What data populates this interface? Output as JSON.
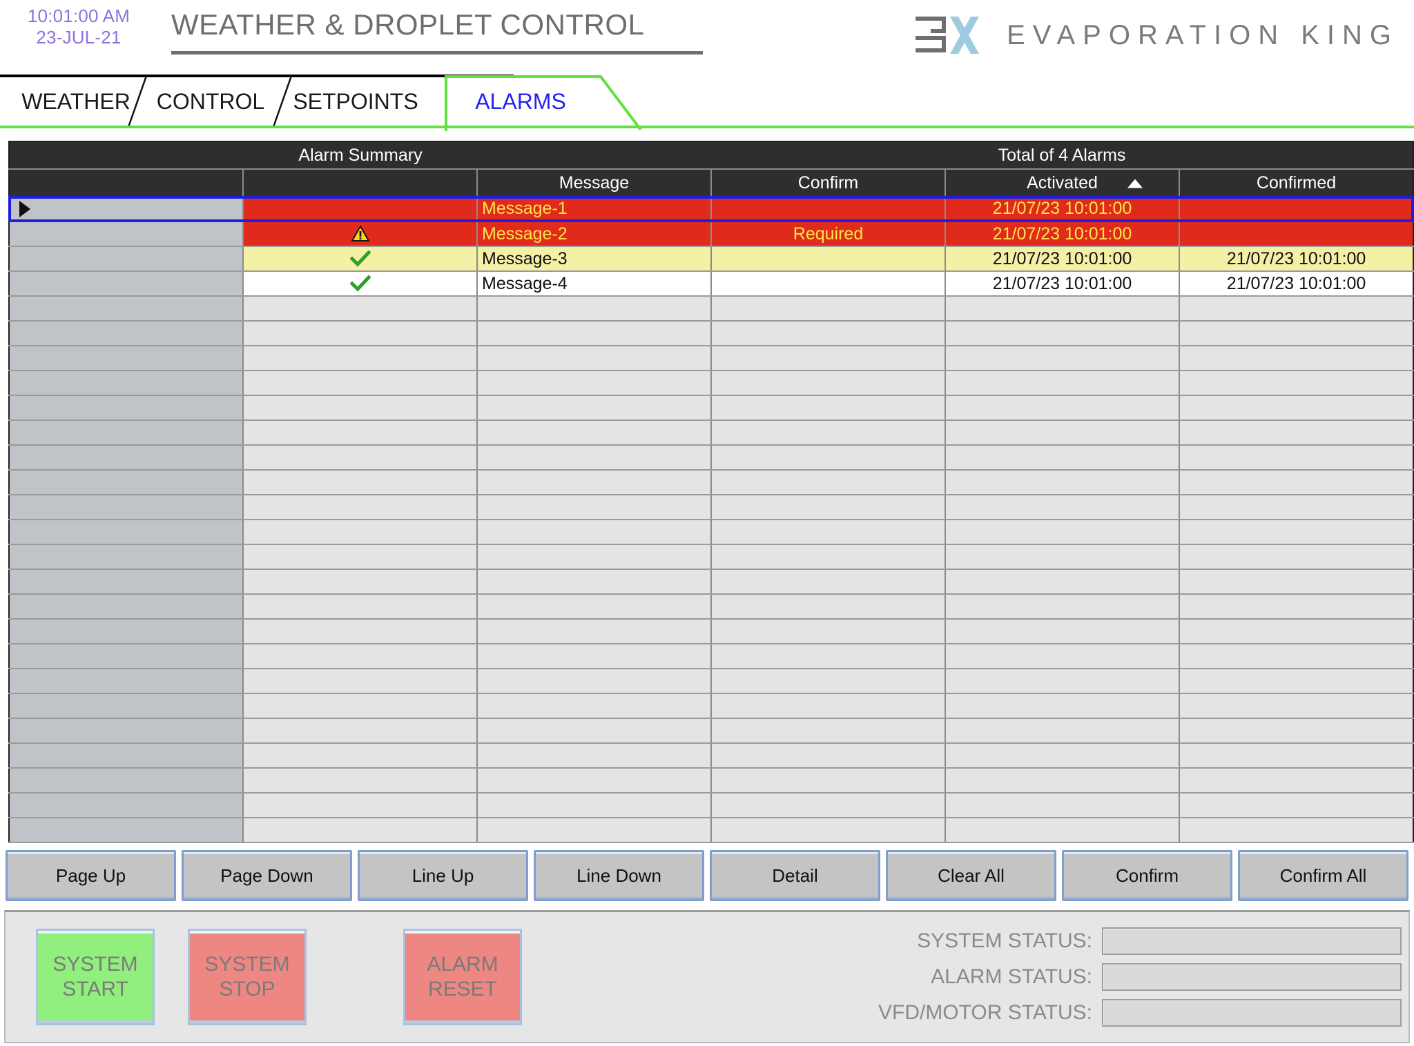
{
  "header": {
    "clock_time": "10:01:00 AM",
    "clock_date": "23-JUL-21",
    "title": "WEATHER & DROPLET CONTROL",
    "brand_name": "EVAPORATION KING",
    "brand_mark_label": "EK"
  },
  "tabs": [
    {
      "label": "WEATHER",
      "active": false
    },
    {
      "label": "CONTROL",
      "active": false
    },
    {
      "label": "SETPOINTS",
      "active": false
    },
    {
      "label": "ALARMS",
      "active": true
    }
  ],
  "alarm_summary": {
    "title": "Alarm Summary",
    "total_text": "Total of 4 Alarms",
    "columns": {
      "message": "Message",
      "confirm": "Confirm",
      "activated": "Activated",
      "confirmed": "Confirmed",
      "sort_column": "Activated",
      "sort_direction": "ascending"
    },
    "rows": [
      {
        "state": "alarm",
        "cursor": true,
        "icon": "none",
        "message": "Message-1",
        "confirm": "",
        "activated": "21/07/23 10:01:00",
        "confirmed": "",
        "selected": true
      },
      {
        "state": "alarm",
        "cursor": false,
        "icon": "warning-triangle",
        "message": "Message-2",
        "confirm": "Required",
        "activated": "21/07/23 10:01:00",
        "confirmed": "",
        "selected": false
      },
      {
        "state": "acknowledged",
        "cursor": false,
        "icon": "green-check",
        "message": "Message-3",
        "confirm": "",
        "activated": "21/07/23 10:01:00",
        "confirmed": "21/07/23 10:01:00",
        "selected": false
      },
      {
        "state": "normal",
        "cursor": false,
        "icon": "green-check",
        "message": "Message-4",
        "confirm": "",
        "activated": "21/07/23 10:01:00",
        "confirmed": "21/07/23 10:01:00",
        "selected": false
      }
    ],
    "empty_row_count": 22
  },
  "toolbar": [
    {
      "label": "Page Up"
    },
    {
      "label": "Page Down"
    },
    {
      "label": "Line Up"
    },
    {
      "label": "Line Down"
    },
    {
      "label": "Detail"
    },
    {
      "label": "Clear All"
    },
    {
      "label": "Confirm"
    },
    {
      "label": "Confirm All"
    }
  ],
  "footer": {
    "buttons": [
      {
        "line1": "SYSTEM",
        "line2": "START",
        "color": "green"
      },
      {
        "line1": "SYSTEM",
        "line2": "STOP",
        "color": "red"
      },
      {
        "line1": "ALARM",
        "line2": "RESET",
        "color": "red"
      }
    ],
    "status_rows": [
      {
        "label": "SYSTEM STATUS:",
        "value": ""
      },
      {
        "label": "ALARM STATUS:",
        "value": ""
      },
      {
        "label": "VFD/MOTOR STATUS:",
        "value": ""
      }
    ]
  },
  "colors": {
    "alarm_bg": "#e02b1c",
    "alarm_text": "#ffe44c",
    "ack_bg": "#f4f0a6",
    "accent_green": "#63e03c",
    "tab_active_text": "#2424f0",
    "clock_text": "#8f72e0",
    "brand_blue": "#9ecbe0",
    "selection_border": "#1d1de0"
  }
}
